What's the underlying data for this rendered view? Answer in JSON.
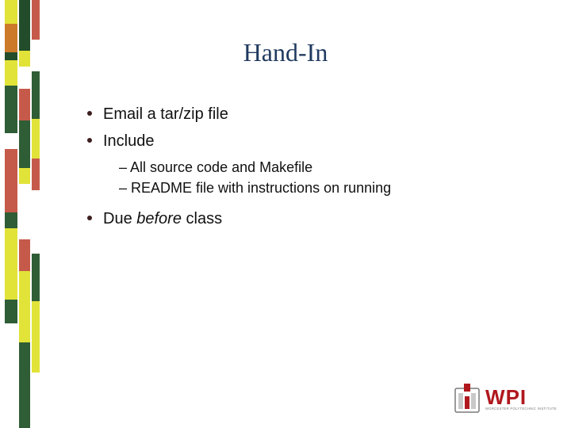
{
  "title": "Hand-In",
  "bullets": {
    "b1": "Email a tar/zip file",
    "b2": "Include",
    "sub1": "–  All source code and Makefile",
    "sub2": "–  README file  with instructions on running",
    "b3_pre": "Due ",
    "b3_italic": "before",
    "b3_post": " class"
  },
  "logo": {
    "text": "WPI",
    "subtext": "WORCESTER POLYTECHNIC INSTITUTE"
  },
  "colors": {
    "title": "#1f3a5f",
    "wpi_red": "#b0181e",
    "wpi_gray": "#7a7a7a"
  }
}
